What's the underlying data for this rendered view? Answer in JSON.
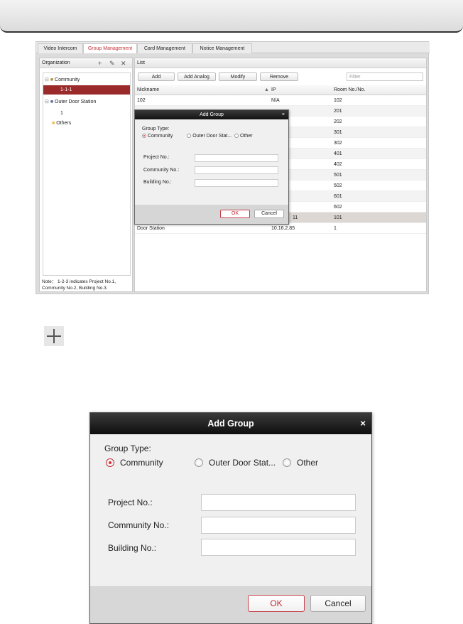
{
  "tabs": [
    "Video Intercom",
    "Group Management",
    "Card Management",
    "Notice Management"
  ],
  "organization": {
    "title": "Organization",
    "tree": [
      "Community",
      "1-1-1",
      "Outer Door Station",
      "1",
      "Others"
    ],
    "note": "Note： 1-2-3 indicates Project No.1, Community No.2, Building No.3."
  },
  "list": {
    "title": "List",
    "buttons": [
      "Add",
      "Add Analog",
      "Modify",
      "Remove"
    ],
    "filter_placeholder": "Filter",
    "columns": [
      "Nickname",
      "IP",
      "Room No./No."
    ],
    "rows": [
      [
        "102",
        "N/A",
        "102"
      ],
      [
        "",
        "",
        "201"
      ],
      [
        "",
        "",
        "202"
      ],
      [
        "",
        "",
        "301"
      ],
      [
        "",
        "",
        "302"
      ],
      [
        "",
        "",
        "401"
      ],
      [
        "",
        "",
        "402"
      ],
      [
        "",
        "",
        "501"
      ],
      [
        "",
        "",
        "502"
      ],
      [
        "",
        "",
        "601"
      ],
      [
        "",
        "",
        "602"
      ],
      [
        "",
        "11",
        "101"
      ],
      [
        "Door Station",
        "10.16.2.85",
        "1"
      ]
    ]
  },
  "dialog": {
    "title": "Add Group",
    "close": "×",
    "group_type_label": "Group Type:",
    "options": [
      "Community",
      "Outer Door Stat...",
      "Other"
    ],
    "fields": [
      "Project No.:",
      "Community No.:",
      "Building No.:"
    ],
    "ok": "OK",
    "cancel": "Cancel"
  }
}
